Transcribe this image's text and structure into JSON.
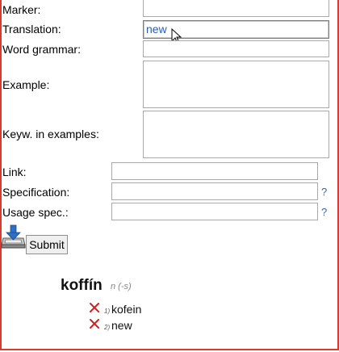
{
  "form": {
    "fields": [
      {
        "label": "Marker:",
        "value": ""
      },
      {
        "label": "Translation:",
        "value": "new"
      },
      {
        "label": "Word grammar:",
        "value": ""
      },
      {
        "label": "Example:",
        "value": ""
      },
      {
        "label": "Keyw. in examples:",
        "value": ""
      },
      {
        "label": "Link:",
        "value": ""
      },
      {
        "label": "Specification:",
        "value": "",
        "help": "?"
      },
      {
        "label": "Usage spec.:",
        "value": "",
        "help": "?"
      }
    ],
    "submit_label": "Submit"
  },
  "entry": {
    "headword": "koffín",
    "grammar": "n (-s)",
    "translations": [
      {
        "num": "1)",
        "text": "kofein"
      },
      {
        "num": "2)",
        "text": "new"
      }
    ]
  },
  "colors": {
    "frame": "#d63c30",
    "link": "#2a6bbf",
    "delete": "#cc2222"
  }
}
